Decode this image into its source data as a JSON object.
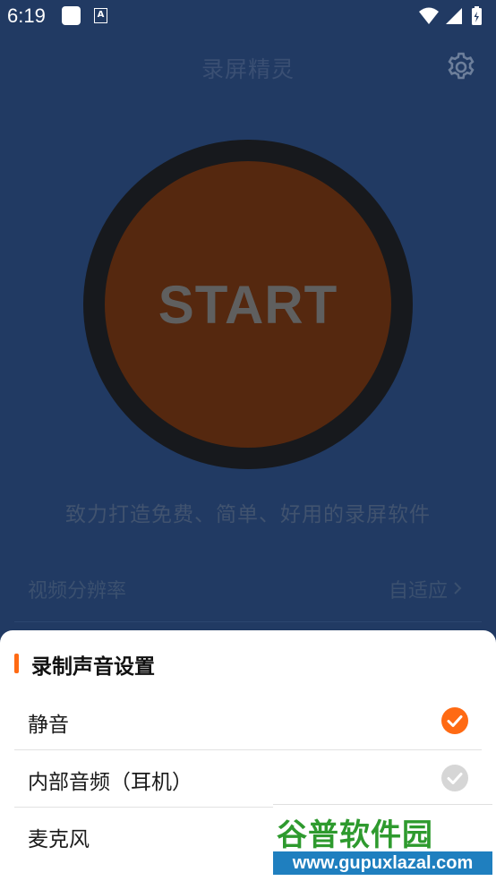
{
  "status_bar": {
    "time": "6:19",
    "notification_icon": "a-icon",
    "a_glyph": "A"
  },
  "header": {
    "title": "录屏精灵",
    "settings_icon": "gear-icon"
  },
  "start_button": {
    "label": "START",
    "colors": {
      "ring": "#17191d",
      "fill": "#55280f",
      "text": "#5f5f5f"
    }
  },
  "slogan": "致力打造免费、简单、好用的录屏软件",
  "settings": [
    {
      "label": "视频分辨率",
      "value": "自适应"
    }
  ],
  "sheet": {
    "title": "录制声音设置",
    "accent_color": "#ff6a13",
    "options": [
      {
        "label": "静音",
        "checked": true
      },
      {
        "label": "内部音频（耳机）",
        "checked": false
      },
      {
        "label": "麦克风",
        "checked": false
      }
    ]
  },
  "watermark": {
    "text": "谷普软件园",
    "url": "www.gupuxlazal.com"
  }
}
